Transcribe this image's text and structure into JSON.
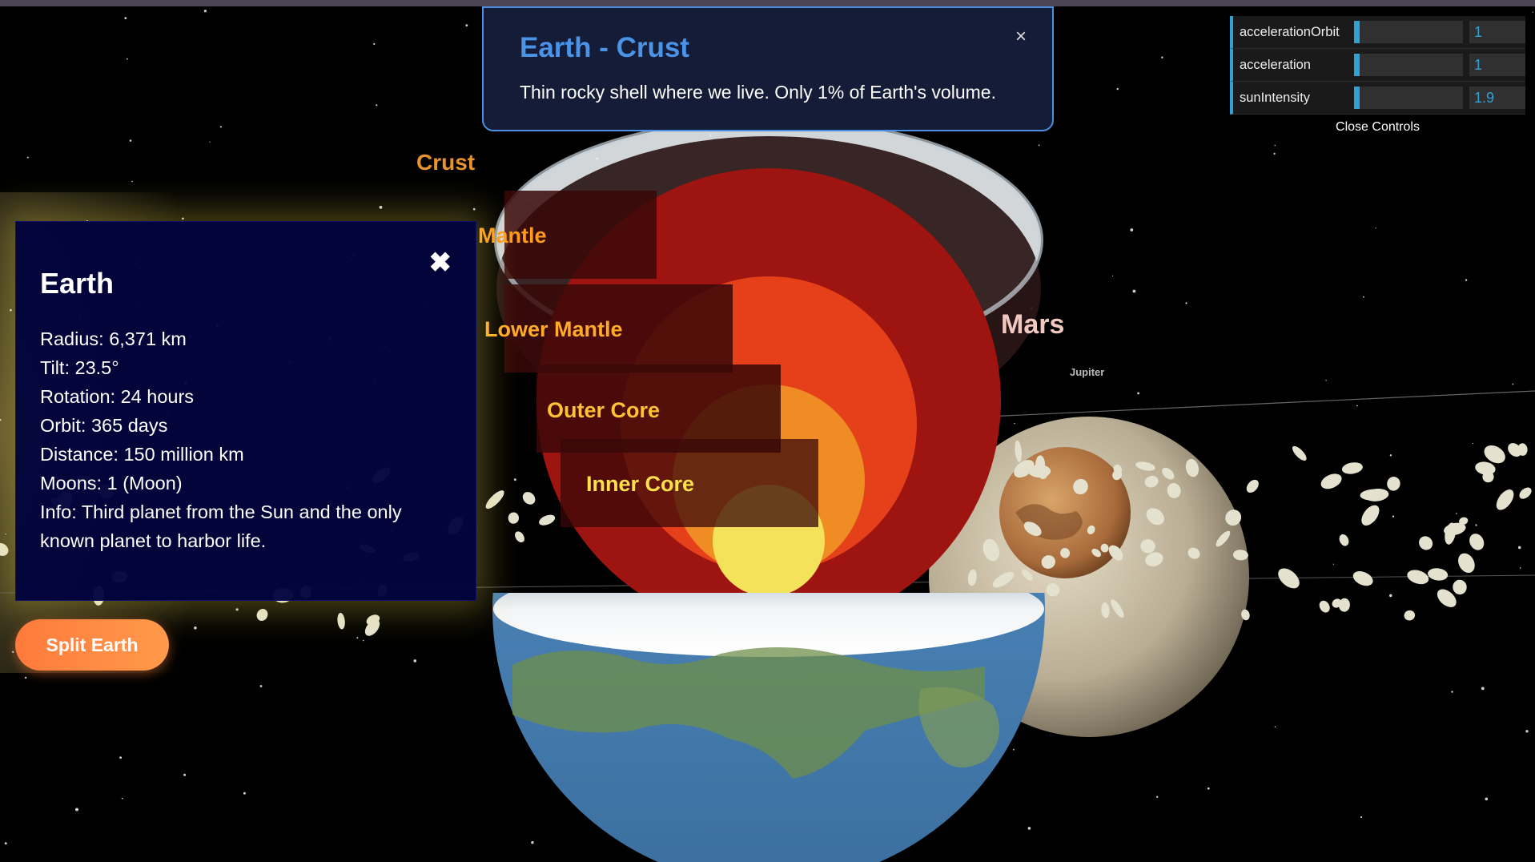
{
  "scene": {
    "layer_labels": {
      "crust": "Crust",
      "mantle": "Mantle",
      "lower_mantle": "Lower Mantle",
      "outer_core": "Outer Core",
      "inner_core": "Inner Core"
    },
    "planet_labels": {
      "mars": "Mars",
      "jupiter": "Jupiter"
    }
  },
  "layer_popup": {
    "title": "Earth - Crust",
    "description": "Thin rocky shell where we live. Only 1% of Earth's volume.",
    "close_symbol": "×"
  },
  "info_panel": {
    "title": "Earth",
    "close_symbol": "✖",
    "lines": [
      "Radius: 6,371 km",
      "Tilt: 23.5°",
      "Rotation: 24 hours",
      "Orbit: 365 days",
      "Distance: 150 million km",
      "Moons: 1 (Moon)",
      "Info: Third planet from the Sun and the only",
      "known planet to harbor life."
    ]
  },
  "split_button": {
    "label": "Split Earth"
  },
  "controls": {
    "rows": [
      {
        "label": "accelerationOrbit",
        "value": "1",
        "fill": 0.05
      },
      {
        "label": "acceleration",
        "value": "1",
        "fill": 0.05
      },
      {
        "label": "sunIntensity",
        "value": "1.9",
        "fill": 0.05
      }
    ],
    "close_label": "Close Controls"
  },
  "colors": {
    "accent_blue": "#2fa1d6",
    "popup_title": "#4a93e6",
    "button_orange": "#ff8a45",
    "label_orange": "#ff9a2a",
    "label_yellow": "#ffe24a"
  }
}
